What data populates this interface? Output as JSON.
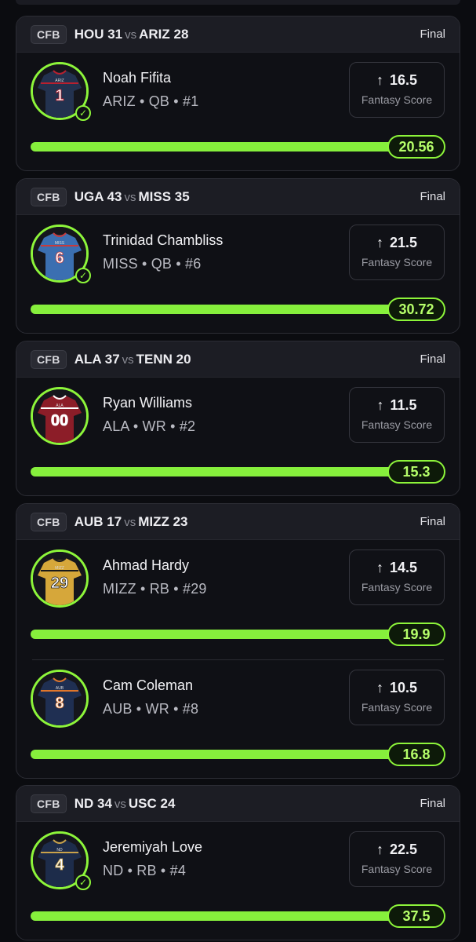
{
  "cards": [
    {
      "league": "CFB",
      "away_team": "HOU",
      "away_score": "31",
      "vs": "vs",
      "home_team": "ARIZ",
      "home_score": "28",
      "status": "Final",
      "players": [
        {
          "name": "Noah Fifita",
          "meta": "ARIZ • QB • #1",
          "line": "16.5",
          "label": "Fantasy Score",
          "result": "20.56",
          "jersey_number": "1",
          "jersey_tag": "ARIZ",
          "jersey_color": "#23324f",
          "trim_color": "#b8202e",
          "number_color": "#ffffff",
          "checked": true,
          "arrow_icon": "arrow-up-icon"
        }
      ]
    },
    {
      "league": "CFB",
      "away_team": "UGA",
      "away_score": "43",
      "vs": "vs",
      "home_team": "MISS",
      "home_score": "35",
      "status": "Final",
      "players": [
        {
          "name": "Trinidad Chambliss",
          "meta": "MISS • QB • #6",
          "line": "21.5",
          "label": "Fantasy Score",
          "result": "30.72",
          "jersey_number": "6",
          "jersey_tag": "MISS",
          "jersey_color": "#3b6fb1",
          "trim_color": "#c83a3a",
          "number_color": "#ffffff",
          "checked": true,
          "arrow_icon": "arrow-up-icon"
        }
      ]
    },
    {
      "league": "CFB",
      "away_team": "ALA",
      "away_score": "37",
      "vs": "vs",
      "home_team": "TENN",
      "home_score": "20",
      "status": "Final",
      "players": [
        {
          "name": "Ryan Williams",
          "meta": "ALA • WR • #2",
          "line": "11.5",
          "label": "Fantasy Score",
          "result": "15.3",
          "jersey_number": "00",
          "jersey_tag": "ALA",
          "jersey_color": "#8c1d28",
          "trim_color": "#ffffff",
          "number_color": "#ffffff",
          "checked": false,
          "arrow_icon": "arrow-up-icon"
        }
      ]
    },
    {
      "league": "CFB",
      "away_team": "AUB",
      "away_score": "17",
      "vs": "vs",
      "home_team": "MIZZ",
      "home_score": "23",
      "status": "Final",
      "players": [
        {
          "name": "Ahmad Hardy",
          "meta": "MIZZ • RB • #29",
          "line": "14.5",
          "label": "Fantasy Score",
          "result": "19.9",
          "jersey_number": "29",
          "jersey_tag": "MIZZ",
          "jersey_color": "#d6a73a",
          "trim_color": "#1a1a1a",
          "number_color": "#ffffff",
          "checked": false,
          "arrow_icon": "arrow-up-icon"
        },
        {
          "name": "Cam Coleman",
          "meta": "AUB • WR • #8",
          "line": "10.5",
          "label": "Fantasy Score",
          "result": "16.8",
          "jersey_number": "8",
          "jersey_tag": "AUB",
          "jersey_color": "#1f2f52",
          "trim_color": "#e0762b",
          "number_color": "#ffffff",
          "checked": false,
          "arrow_icon": "arrow-up-icon"
        }
      ]
    },
    {
      "league": "CFB",
      "away_team": "ND",
      "away_score": "34",
      "vs": "vs",
      "home_team": "USC",
      "home_score": "24",
      "status": "Final",
      "players": [
        {
          "name": "Jeremiyah Love",
          "meta": "ND • RB • #4",
          "line": "22.5",
          "label": "Fantasy Score",
          "result": "37.5",
          "jersey_number": "4",
          "jersey_tag": "ND",
          "jersey_color": "#1d2c4a",
          "trim_color": "#c9a24a",
          "number_color": "#ffffff",
          "checked": true,
          "arrow_icon": "arrow-up-icon"
        }
      ]
    }
  ],
  "colors": {
    "accent": "#8df53a",
    "background": "#0b0c10",
    "card": "#0f1015",
    "header": "#1c1d24"
  }
}
